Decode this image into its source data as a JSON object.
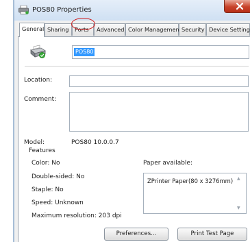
{
  "window": {
    "title": "POS80 Properties"
  },
  "tabs": [
    {
      "label": "General",
      "active": true
    },
    {
      "label": "Sharing"
    },
    {
      "label": "Ports",
      "highlighted": true
    },
    {
      "label": "Advanced"
    },
    {
      "label": "Color Management"
    },
    {
      "label": "Security"
    },
    {
      "label": "Device Settings"
    }
  ],
  "printer": {
    "name": "POS80"
  },
  "fields": {
    "location_label": "Location:",
    "location_value": "",
    "comment_label": "Comment:",
    "comment_value": ""
  },
  "model": {
    "label": "Model:",
    "value": "POS80 10.0.0.7"
  },
  "features": {
    "title": "Features",
    "color": "Color: No",
    "double_sided": "Double-sided: No",
    "staple": "Staple: No",
    "speed": "Speed: Unknown",
    "max_resolution": "Maximum resolution: 203 dpi"
  },
  "paper": {
    "label": "Paper available:",
    "items": [
      "ZPrinter Paper(80 x 3276mm)"
    ]
  },
  "buttons": {
    "preferences": "Preferences...",
    "print_test_page": "Print Test Page"
  },
  "colors": {
    "selection": "#3399ff",
    "close_button": "#c8432a",
    "annotation": "#d02020"
  }
}
